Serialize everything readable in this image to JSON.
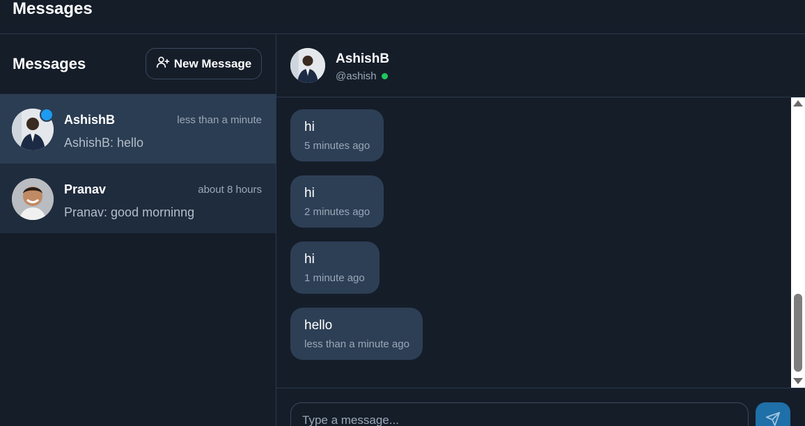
{
  "topbar": {
    "title": "Messages"
  },
  "sidebar": {
    "title": "Messages",
    "new_message_label": "New Message",
    "conversations": [
      {
        "name": "AshishB",
        "time": "less than a minute",
        "preview": "AshishB: hello",
        "unread": true
      },
      {
        "name": "Pranav",
        "time": "about 8 hours",
        "preview": "Pranav: good morninng",
        "unread": false
      }
    ]
  },
  "chat": {
    "name": "AshishB",
    "handle": "@ashish",
    "status": "online",
    "messages": [
      {
        "text": "hi",
        "time": "5 minutes ago"
      },
      {
        "text": "hi",
        "time": "2 minutes ago"
      },
      {
        "text": "hi",
        "time": "1 minute ago"
      },
      {
        "text": "hello",
        "time": "less than a minute ago"
      }
    ],
    "input_placeholder": "Type a message...",
    "input_value": ""
  },
  "colors": {
    "background": "#151d29",
    "active_conversation": "#2b3d52",
    "bubble": "#2d3f55",
    "unread_dot": "#1d9bf0",
    "online_dot": "#22c55e",
    "send_button": "#1f6fa8"
  }
}
